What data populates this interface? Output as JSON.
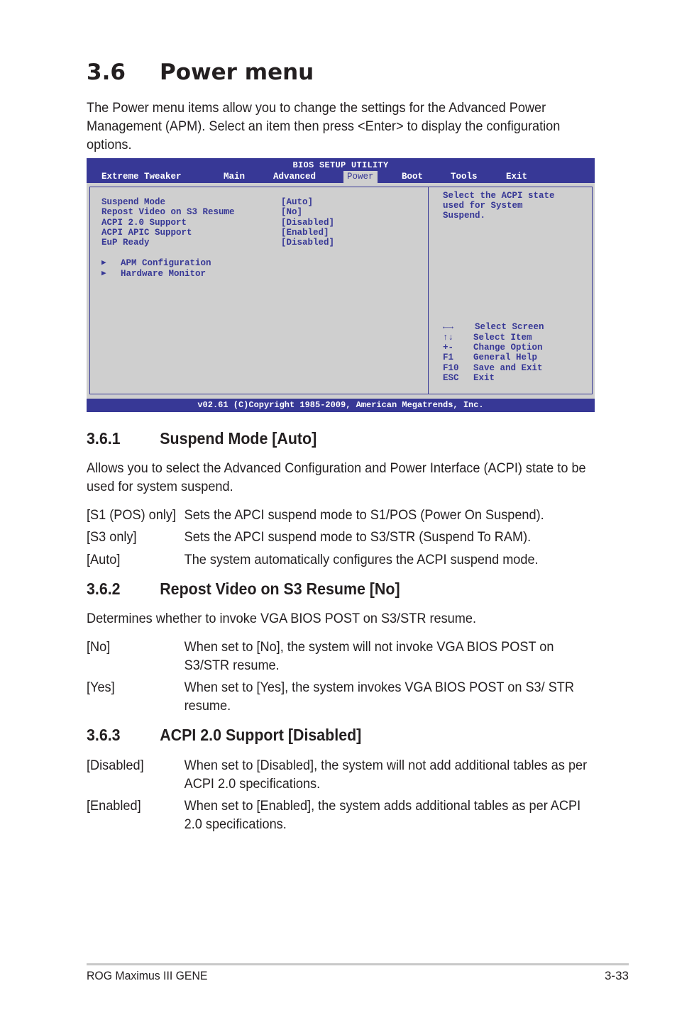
{
  "section": {
    "number": "3.6",
    "title": "Power menu",
    "intro": "The Power menu items allow you to change the settings for the Advanced Power Management (APM). Select an item then press <Enter> to display the configuration options."
  },
  "bios": {
    "title": "BIOS SETUP UTILITY",
    "menu": [
      "Extreme Tweaker",
      "Main",
      "Advanced",
      "Power",
      "Boot",
      "Tools",
      "Exit"
    ],
    "active_menu": "Power",
    "settings": [
      {
        "label": "Suspend Mode",
        "value": "[Auto]"
      },
      {
        "label": "Repost Video on S3 Resume",
        "value": "[No]"
      },
      {
        "label": "ACPI 2.0 Support",
        "value": "[Disabled]"
      },
      {
        "label": "ACPI APIC Support",
        "value": "[Enabled]"
      },
      {
        "label": "EuP Ready",
        "value": "[Disabled]"
      }
    ],
    "submenus": [
      "APM Configuration",
      "Hardware Monitor"
    ],
    "help_text": [
      "Select the ACPI state",
      "used for System",
      "Suspend."
    ],
    "keys": [
      {
        "key": "←→",
        "action": "Select Screen"
      },
      {
        "key": "↑↓",
        "action": "Select Item"
      },
      {
        "key": "+-",
        "action": "Change Option"
      },
      {
        "key": "F1",
        "action": "General Help"
      },
      {
        "key": "F10",
        "action": "Save and Exit"
      },
      {
        "key": "ESC",
        "action": "Exit"
      }
    ],
    "footer": "v02.61 (C)Copyright 1985-2009, American Megatrends, Inc.",
    "colors": {
      "bar": "#373896",
      "background": "#cfcfcf",
      "text": "#373896"
    }
  },
  "subsections": [
    {
      "number": "3.6.1",
      "title": "Suspend Mode [Auto]",
      "description": "Allows you to select the Advanced Configuration and Power Interface (ACPI) state to be used for system suspend.",
      "options": [
        {
          "key": "[S1 (POS) only]",
          "desc": "Sets the APCI suspend mode to S1/POS (Power On Suspend)."
        },
        {
          "key": "[S3 only]",
          "desc": "Sets the APCI suspend mode to S3/STR (Suspend To RAM)."
        },
        {
          "key": "[Auto]",
          "desc": "The system automatically configures the ACPI suspend mode."
        }
      ]
    },
    {
      "number": "3.6.2",
      "title": "Repost Video on S3 Resume [No]",
      "description": "Determines whether to invoke VGA BIOS POST on S3/STR resume.",
      "options": [
        {
          "key": "[No]",
          "desc": "When set to [No], the system will not invoke VGA BIOS POST on S3/STR resume."
        },
        {
          "key": "[Yes]",
          "desc": "When set to [Yes], the system invokes VGA BIOS POST on S3/ STR resume."
        }
      ]
    },
    {
      "number": "3.6.3",
      "title": "ACPI 2.0 Support [Disabled]",
      "options": [
        {
          "key": "[Disabled]",
          "desc": "When set to [Disabled], the system will not add additional tables as per ACPI 2.0 specifications."
        },
        {
          "key": "[Enabled]",
          "desc": "When set to [Enabled], the system adds additional tables as per ACPI 2.0 specifications."
        }
      ]
    }
  ],
  "page_footer": {
    "product": "ROG Maximus III GENE",
    "page": "3-33"
  }
}
